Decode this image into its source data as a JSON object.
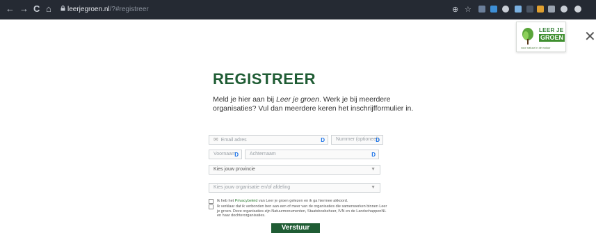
{
  "browser": {
    "back": "←",
    "forward": "→",
    "reload": "C",
    "home": "⌂",
    "lock": "🔒",
    "url_domain": "leerjegroen.nl",
    "url_path": "/?#registreer",
    "zoom_icon": "⊕",
    "star_icon": "☆"
  },
  "modal": {
    "logo": {
      "line1": "LEER JE",
      "line2": "GROEN",
      "tagline": "voor natuur in de natuur"
    },
    "close": "✕"
  },
  "form": {
    "title": "REGISTREER",
    "intro_part1": "Meld je hier aan bij ",
    "intro_em": "Leer je groen",
    "intro_part2": ". Werk je bij meerdere organisaties? Vul dan meerdere keren het inschrijfformulier in.",
    "email_placeholder": "Email adres",
    "phone_placeholder": "Nummer (optioneel)",
    "firstname_placeholder": "Voornaam",
    "lastname_placeholder": "Achternaam",
    "province_select": "Kies jouw provincie",
    "org_select": "Kies jouw organisatie en/of afdeling",
    "privacy_pre": "Ik heb het ",
    "privacy_link": "Privacybeleid",
    "privacy_post": " van Leer je groen gelezen en ik ga hiermee akkoord.",
    "affiliation": "Ik verklaar dat ik verbonden ben aan een of meer van de organisaties die samenwerken binnen Leer je groen. Deze organisaties zijn Natuurmonumenten, Staatsbosbeheer, IVN en de LandschappenNL en haar dochterorganisaties.",
    "submit": "Verstuur"
  }
}
